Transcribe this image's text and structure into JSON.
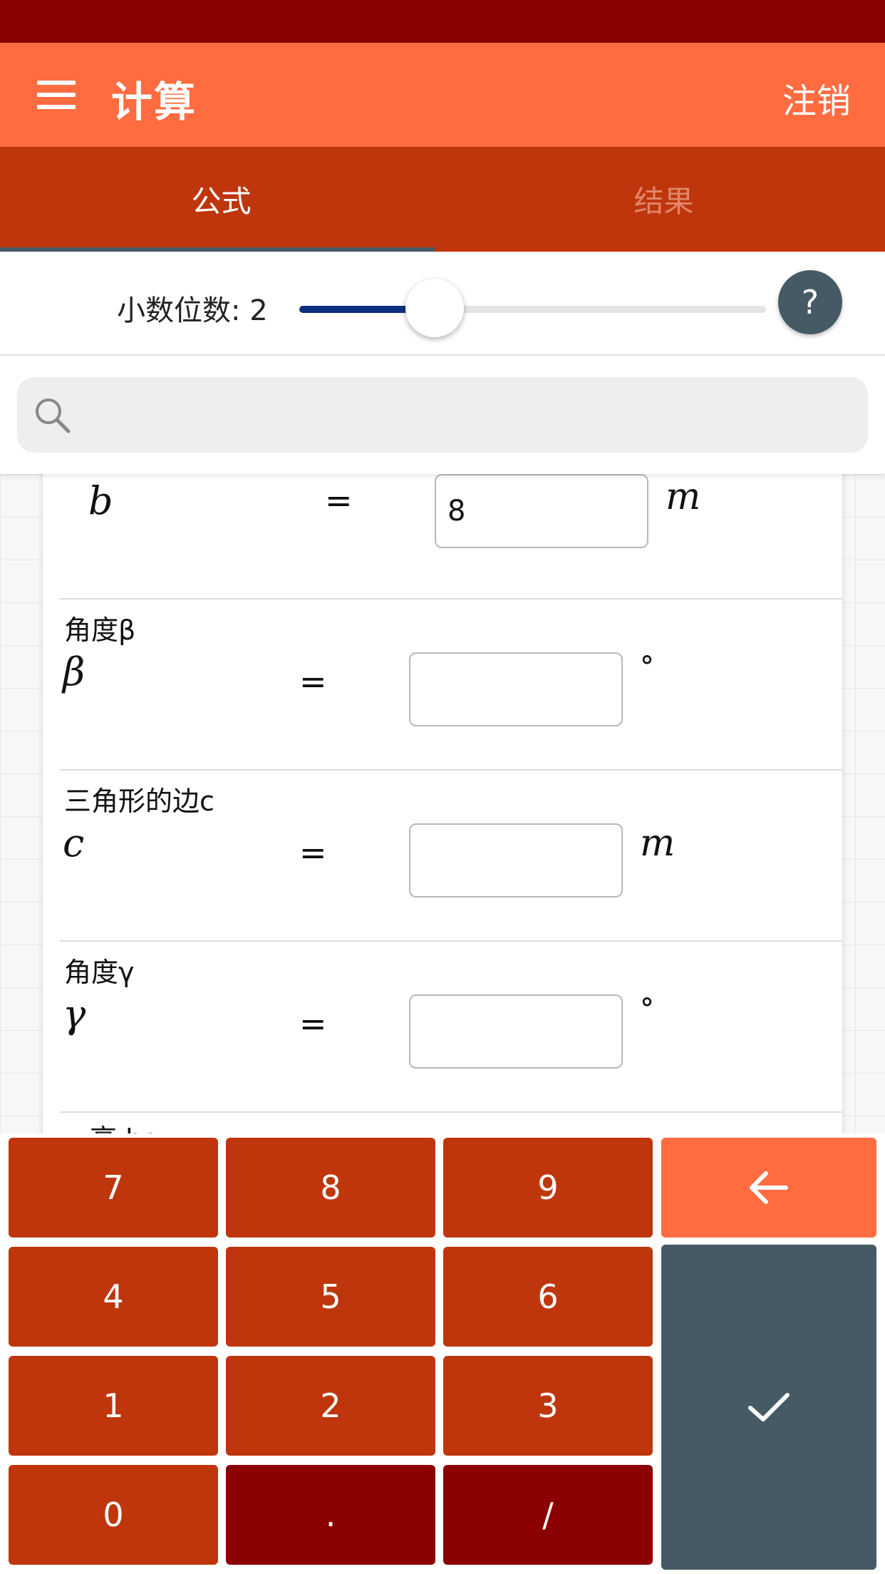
{
  "app_bar": {
    "title": "计算",
    "logout_label": "注销",
    "menu_icon": "hamburger-menu-icon"
  },
  "tabs": [
    {
      "label": "公式",
      "active": true
    },
    {
      "label": "结果",
      "active": false
    }
  ],
  "decimal": {
    "label": "小数位数:  2",
    "value": 2,
    "slider_fraction": 0.29,
    "help_label": "?"
  },
  "search": {
    "placeholder": "",
    "icon": "search-icon"
  },
  "fields": [
    {
      "label": "",
      "symbol": "b",
      "equals": "=",
      "value": "8",
      "unit": "m"
    },
    {
      "label": "角度β",
      "symbol": "β",
      "equals": "=",
      "value": "",
      "unit": "°"
    },
    {
      "label": "三角形的边c",
      "symbol": "c",
      "equals": "=",
      "value": "",
      "unit": "m"
    },
    {
      "label": "角度γ",
      "symbol": "γ",
      "equals": "=",
      "value": "",
      "unit": "°"
    }
  ],
  "partial_next_label": "高 ha",
  "keypad": {
    "keys": [
      "7",
      "8",
      "9",
      "4",
      "5",
      "6",
      "1",
      "2",
      "3",
      "0",
      ".",
      "/"
    ],
    "backspace_icon": "arrow-left-icon",
    "confirm_icon": "check-icon"
  },
  "colors": {
    "status_bar": "#8b0000",
    "app_bar": "#fe6c40",
    "tabs": "#bf360c",
    "accent_slate": "#455a64",
    "slider_fill": "#0d2f7d"
  }
}
